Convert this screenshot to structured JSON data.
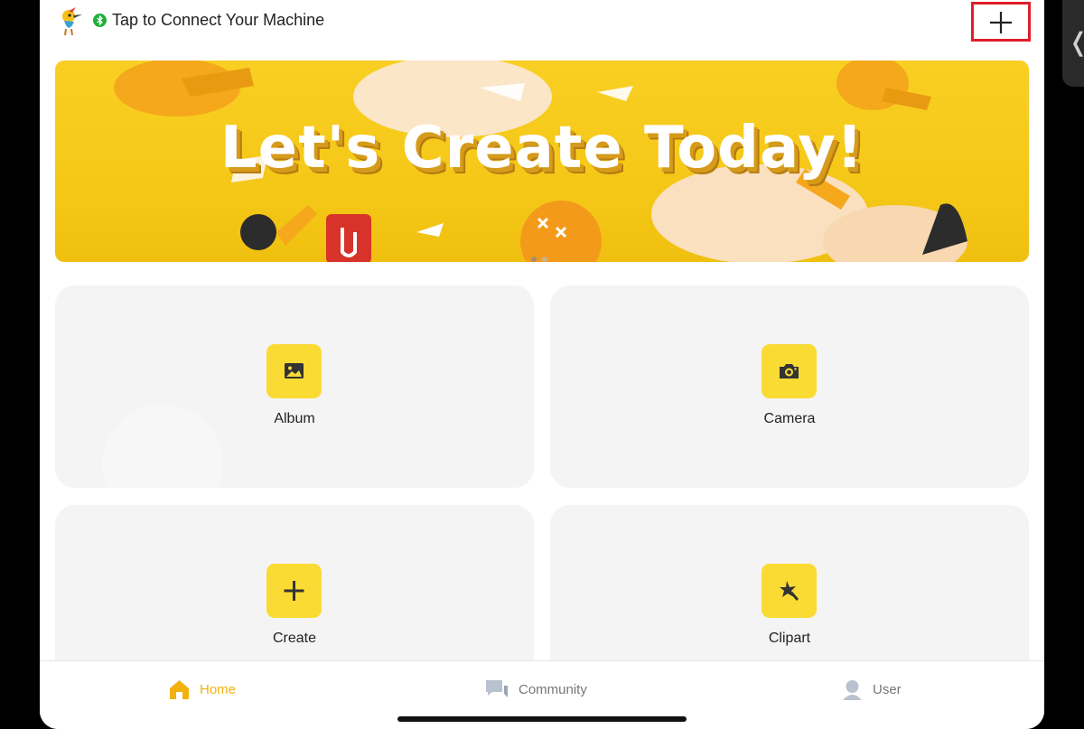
{
  "header": {
    "connect_label": "Tap to Connect Your Machine"
  },
  "banner": {
    "title": "Let's Create Today!",
    "page_count": 2,
    "active_page": 2
  },
  "cards": [
    {
      "label": "Album",
      "icon": "image-icon"
    },
    {
      "label": "Camera",
      "icon": "camera-icon"
    },
    {
      "label": "Create",
      "icon": "plus-icon"
    },
    {
      "label": "Clipart",
      "icon": "clipart-icon"
    }
  ],
  "tabs": [
    {
      "label": "Home",
      "icon": "home-icon",
      "active": true
    },
    {
      "label": "Community",
      "icon": "chat-icon",
      "active": false
    },
    {
      "label": "User",
      "icon": "user-icon",
      "active": false
    }
  ],
  "colors": {
    "accent": "#fadb33",
    "tab_active": "#f2b10f",
    "highlight_box": "#e01e2a",
    "bluetooth": "#1fae3a"
  }
}
